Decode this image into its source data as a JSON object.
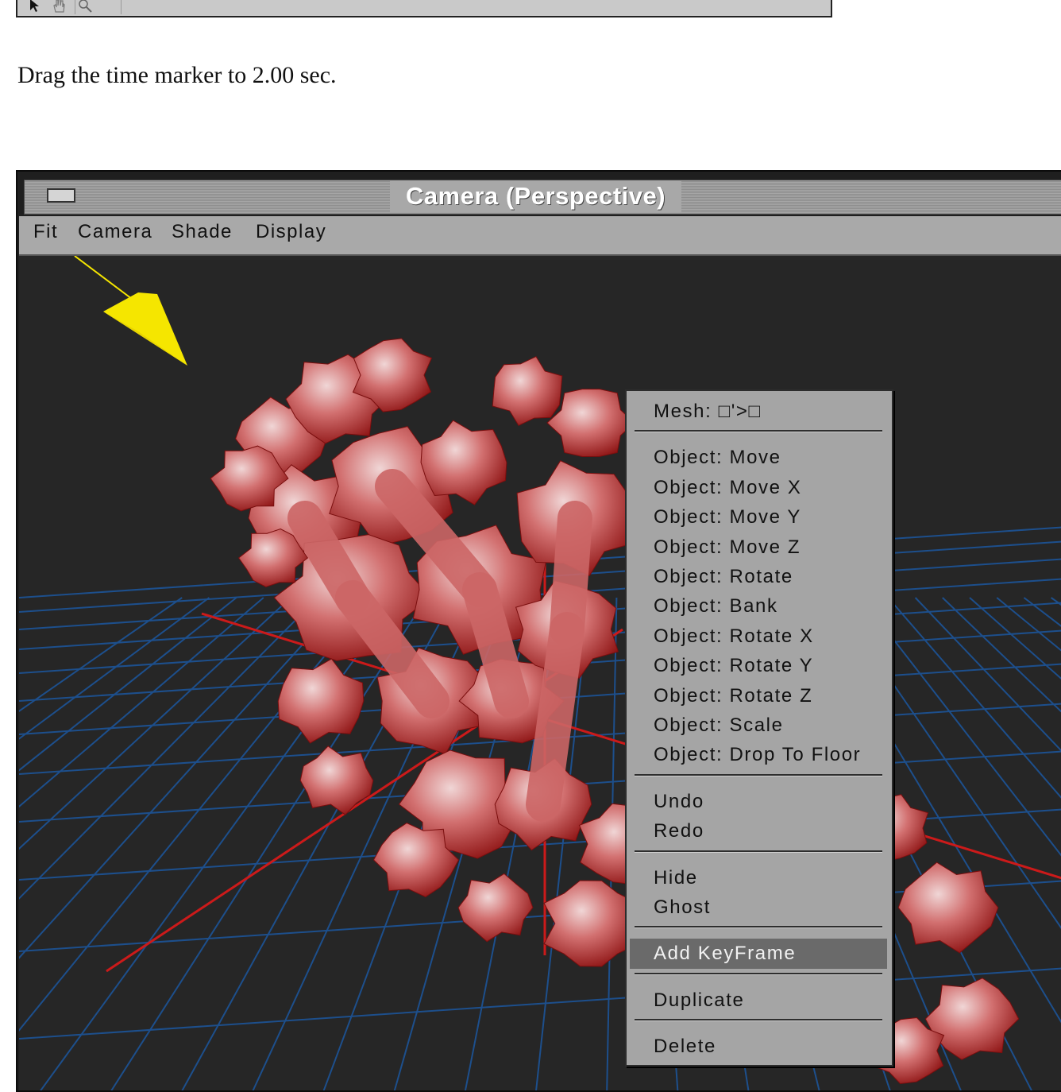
{
  "instruction": "Drag the time marker to 2.00 sec.",
  "toolbar": {
    "tools": [
      "pointer-tool",
      "hand-tool",
      "zoom-tool"
    ]
  },
  "window": {
    "title": "Camera  (Perspective)",
    "menus": [
      "Fit",
      "Camera",
      "Shade",
      "Display"
    ]
  },
  "context_menu": {
    "groups": [
      [
        "Mesh: □'>□"
      ],
      [
        "Object: Move",
        "Object: Move X",
        "Object: Move Y",
        "Object: Move Z",
        "Object: Rotate",
        "Object: Bank",
        "Object: Rotate X",
        "Object: Rotate Y",
        "Object: Rotate Z",
        "Object: Scale",
        "Object: Drop To Floor"
      ],
      [
        "Undo",
        "Redo"
      ],
      [
        "Hide",
        "Ghost"
      ],
      [
        "Add KeyFrame"
      ],
      [
        "Duplicate"
      ],
      [
        "Delete"
      ]
    ],
    "highlighted": "Add KeyFrame"
  },
  "colors": {
    "viewport_bg": "#262626",
    "grid": "#1d4f8c",
    "axis": "#cc1a1a",
    "light": "#f5e600",
    "object": "#c43a3a"
  }
}
